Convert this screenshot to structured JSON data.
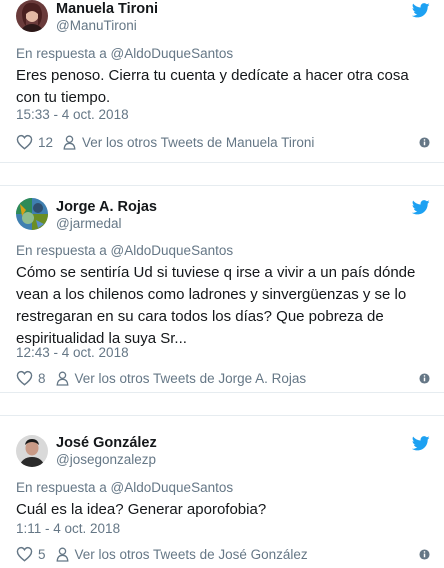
{
  "colors": {
    "bird": "#1da1f2",
    "muted": "#657786",
    "text": "#14171a"
  },
  "tweets": [
    {
      "name": "Manuela Tironi",
      "handle": "@ManuTironi",
      "reply_to": "En respuesta a @AldoDuqueSantos",
      "text": "Eres penoso. Cierra tu cuenta y dedícate a hacer otra cosa con tu tiempo.",
      "timestamp": "15:33 - 4 oct. 2018",
      "likes": "12",
      "other_tweets": "Ver los otros Tweets de Manuela Tironi",
      "avatar_icon": "avatar-photo-woman",
      "bird_icon": "twitter-bird-icon"
    },
    {
      "name": "Jorge A. Rojas",
      "handle": "@jarmedal",
      "reply_to": "En respuesta a @AldoDuqueSantos",
      "text": "Cómo se sentiría Ud si tuviese q irse a vivir a un país dónde vean a los chilenos como ladrones y sinvergüenzas y se lo restregaran en su cara todos los días? Que pobreza de espiritualidad la suya Sr...",
      "timestamp": "12:43 - 4 oct. 2018",
      "likes": "8",
      "other_tweets": "Ver los otros Tweets de Jorge A. Rojas",
      "avatar_icon": "avatar-photo-colorful",
      "bird_icon": "twitter-bird-icon"
    },
    {
      "name": "José González",
      "handle": "@josegonzalezp",
      "reply_to": "En respuesta a @AldoDuqueSantos",
      "text": "Cuál es la idea? Generar aporofobia?",
      "timestamp": "1:11 - 4 oct. 2018",
      "likes": "5",
      "other_tweets": "Ver los otros Tweets de José González",
      "avatar_icon": "avatar-photo-man",
      "bird_icon": "twitter-bird-icon"
    }
  ]
}
